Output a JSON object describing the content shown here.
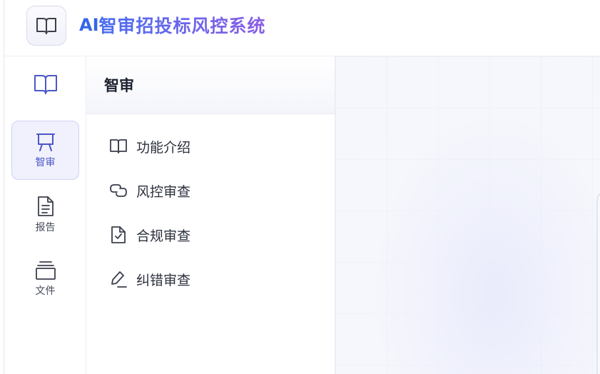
{
  "header": {
    "title_ai": "AI",
    "title_rest": "智审招投标风控系统",
    "logo_icon": "book-open-icon"
  },
  "rail": {
    "top_icon": "book-open-icon",
    "items": [
      {
        "label": "智审",
        "icon": "presentation-board-icon",
        "active": true
      },
      {
        "label": "报告",
        "icon": "document-text-icon",
        "active": false
      },
      {
        "label": "文件",
        "icon": "stacked-files-icon",
        "active": false
      }
    ]
  },
  "menu": {
    "title": "智审",
    "items": [
      {
        "label": "功能介绍",
        "icon": "book-open-icon"
      },
      {
        "label": "风控审查",
        "icon": "link-chain-icon"
      },
      {
        "label": "合规审查",
        "icon": "file-check-icon"
      },
      {
        "label": "纠错审查",
        "icon": "pen-edit-icon"
      }
    ]
  },
  "colors": {
    "accent": "#4b57c7",
    "title_gradient_start": "#4a6ef0",
    "title_gradient_end": "#8a5de6",
    "active_bg": "#f0f1fc"
  }
}
